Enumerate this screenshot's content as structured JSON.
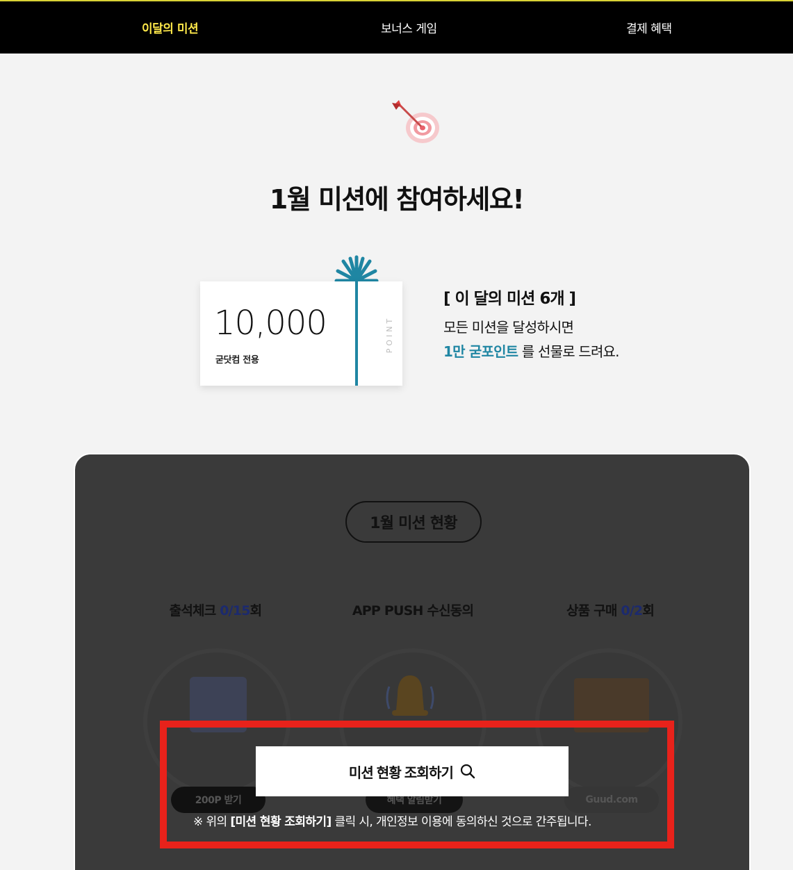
{
  "nav": {
    "items": [
      {
        "label": "이달의 미션",
        "active": true
      },
      {
        "label": "보너스 게임",
        "active": false
      },
      {
        "label": "결제 혜택",
        "active": false
      }
    ],
    "active_color": "#ffe94a"
  },
  "hero": {
    "icon": "dart-target-icon",
    "headline": "1월 미션에 참여하세요!"
  },
  "point_card": {
    "amount": "10,000",
    "subtitle": "굳닷컴 전용",
    "vertical_label": "POINT",
    "ribbon_color": "#1f86a3"
  },
  "mission_info": {
    "title": "[ 이 달의 미션 6개 ]",
    "line1": "모든 미션을 달성하시면",
    "highlight": "1만 굳포인트",
    "line2_rest": " 를 선물로 드려요."
  },
  "status_panel": {
    "pill_label": "1월 미션 현황",
    "missions": [
      {
        "name": "출석체크 ",
        "count": "0/15",
        "suffix": "회",
        "icon": "calendar-icon",
        "button": "200P 받기"
      },
      {
        "name": "APP PUSH 수신동의",
        "count": "",
        "suffix": "",
        "icon": "bell-icon",
        "button": "혜택 알림받기"
      },
      {
        "name": "상품 구매 ",
        "count": "0/2",
        "suffix": "회",
        "icon": "package-box-icon",
        "button": "Guud.com"
      }
    ]
  },
  "overlay": {
    "lookup_button": "미션 현황 조회하기",
    "notice_prefix": "※ 위의 ",
    "notice_bold": "[미션 현황 조회하기]",
    "notice_suffix": " 클릭 시, 개인정보 이용에 동의하신 것으로 간주됩니다.",
    "highlight_color": "#e8221b"
  }
}
